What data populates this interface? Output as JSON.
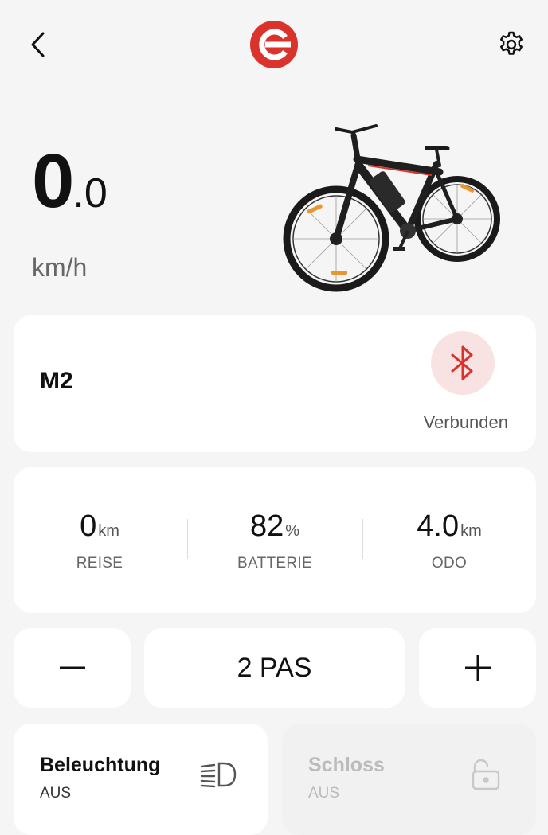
{
  "header": {
    "back_icon": "chevron-left-icon",
    "logo": "brand-logo-e",
    "settings_icon": "gear-icon"
  },
  "speed": {
    "integer": "0",
    "decimal": ".0",
    "unit": "km/h"
  },
  "device": {
    "name": "M2",
    "status": "Verbunden",
    "icon": "bluetooth-icon"
  },
  "stats": [
    {
      "value": "0",
      "unit": "km",
      "label": "REISE"
    },
    {
      "value": "82",
      "unit": "%",
      "label": "BATTERIE"
    },
    {
      "value": "4.0",
      "unit": "km",
      "label": "ODO"
    }
  ],
  "assist": {
    "minus": "−",
    "level": "2 PAS",
    "plus": "+"
  },
  "light": {
    "title": "Beleuchtung",
    "state": "AUS",
    "icon": "headlight-icon"
  },
  "lock": {
    "title": "Schloss",
    "state": "AUS",
    "icon": "unlock-icon"
  },
  "colors": {
    "brand": "#d9332b",
    "background": "#f5f5f5",
    "bluetooth_bg": "#f9e3e2"
  }
}
